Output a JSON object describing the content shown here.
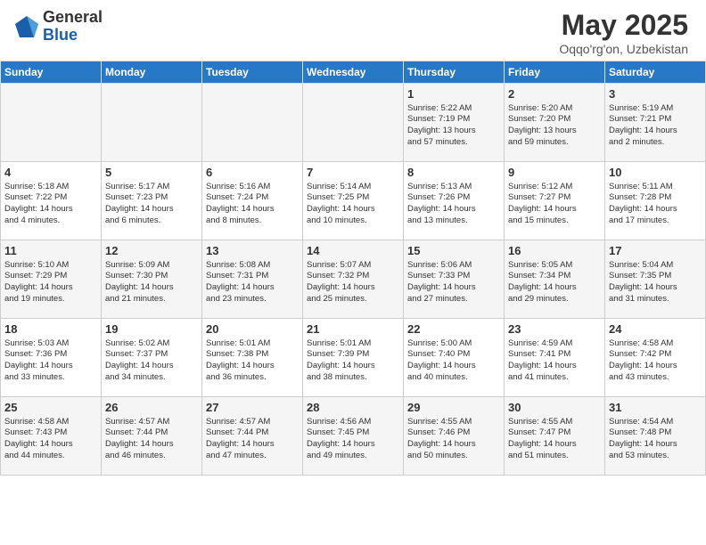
{
  "header": {
    "logo_general": "General",
    "logo_blue": "Blue",
    "month": "May 2025",
    "location": "Oqqo'rg'on, Uzbekistan"
  },
  "days_of_week": [
    "Sunday",
    "Monday",
    "Tuesday",
    "Wednesday",
    "Thursday",
    "Friday",
    "Saturday"
  ],
  "weeks": [
    [
      {
        "day": "",
        "info": ""
      },
      {
        "day": "",
        "info": ""
      },
      {
        "day": "",
        "info": ""
      },
      {
        "day": "",
        "info": ""
      },
      {
        "day": "1",
        "info": "Sunrise: 5:22 AM\nSunset: 7:19 PM\nDaylight: 13 hours\nand 57 minutes."
      },
      {
        "day": "2",
        "info": "Sunrise: 5:20 AM\nSunset: 7:20 PM\nDaylight: 13 hours\nand 59 minutes."
      },
      {
        "day": "3",
        "info": "Sunrise: 5:19 AM\nSunset: 7:21 PM\nDaylight: 14 hours\nand 2 minutes."
      }
    ],
    [
      {
        "day": "4",
        "info": "Sunrise: 5:18 AM\nSunset: 7:22 PM\nDaylight: 14 hours\nand 4 minutes."
      },
      {
        "day": "5",
        "info": "Sunrise: 5:17 AM\nSunset: 7:23 PM\nDaylight: 14 hours\nand 6 minutes."
      },
      {
        "day": "6",
        "info": "Sunrise: 5:16 AM\nSunset: 7:24 PM\nDaylight: 14 hours\nand 8 minutes."
      },
      {
        "day": "7",
        "info": "Sunrise: 5:14 AM\nSunset: 7:25 PM\nDaylight: 14 hours\nand 10 minutes."
      },
      {
        "day": "8",
        "info": "Sunrise: 5:13 AM\nSunset: 7:26 PM\nDaylight: 14 hours\nand 13 minutes."
      },
      {
        "day": "9",
        "info": "Sunrise: 5:12 AM\nSunset: 7:27 PM\nDaylight: 14 hours\nand 15 minutes."
      },
      {
        "day": "10",
        "info": "Sunrise: 5:11 AM\nSunset: 7:28 PM\nDaylight: 14 hours\nand 17 minutes."
      }
    ],
    [
      {
        "day": "11",
        "info": "Sunrise: 5:10 AM\nSunset: 7:29 PM\nDaylight: 14 hours\nand 19 minutes."
      },
      {
        "day": "12",
        "info": "Sunrise: 5:09 AM\nSunset: 7:30 PM\nDaylight: 14 hours\nand 21 minutes."
      },
      {
        "day": "13",
        "info": "Sunrise: 5:08 AM\nSunset: 7:31 PM\nDaylight: 14 hours\nand 23 minutes."
      },
      {
        "day": "14",
        "info": "Sunrise: 5:07 AM\nSunset: 7:32 PM\nDaylight: 14 hours\nand 25 minutes."
      },
      {
        "day": "15",
        "info": "Sunrise: 5:06 AM\nSunset: 7:33 PM\nDaylight: 14 hours\nand 27 minutes."
      },
      {
        "day": "16",
        "info": "Sunrise: 5:05 AM\nSunset: 7:34 PM\nDaylight: 14 hours\nand 29 minutes."
      },
      {
        "day": "17",
        "info": "Sunrise: 5:04 AM\nSunset: 7:35 PM\nDaylight: 14 hours\nand 31 minutes."
      }
    ],
    [
      {
        "day": "18",
        "info": "Sunrise: 5:03 AM\nSunset: 7:36 PM\nDaylight: 14 hours\nand 33 minutes."
      },
      {
        "day": "19",
        "info": "Sunrise: 5:02 AM\nSunset: 7:37 PM\nDaylight: 14 hours\nand 34 minutes."
      },
      {
        "day": "20",
        "info": "Sunrise: 5:01 AM\nSunset: 7:38 PM\nDaylight: 14 hours\nand 36 minutes."
      },
      {
        "day": "21",
        "info": "Sunrise: 5:01 AM\nSunset: 7:39 PM\nDaylight: 14 hours\nand 38 minutes."
      },
      {
        "day": "22",
        "info": "Sunrise: 5:00 AM\nSunset: 7:40 PM\nDaylight: 14 hours\nand 40 minutes."
      },
      {
        "day": "23",
        "info": "Sunrise: 4:59 AM\nSunset: 7:41 PM\nDaylight: 14 hours\nand 41 minutes."
      },
      {
        "day": "24",
        "info": "Sunrise: 4:58 AM\nSunset: 7:42 PM\nDaylight: 14 hours\nand 43 minutes."
      }
    ],
    [
      {
        "day": "25",
        "info": "Sunrise: 4:58 AM\nSunset: 7:43 PM\nDaylight: 14 hours\nand 44 minutes."
      },
      {
        "day": "26",
        "info": "Sunrise: 4:57 AM\nSunset: 7:44 PM\nDaylight: 14 hours\nand 46 minutes."
      },
      {
        "day": "27",
        "info": "Sunrise: 4:57 AM\nSunset: 7:44 PM\nDaylight: 14 hours\nand 47 minutes."
      },
      {
        "day": "28",
        "info": "Sunrise: 4:56 AM\nSunset: 7:45 PM\nDaylight: 14 hours\nand 49 minutes."
      },
      {
        "day": "29",
        "info": "Sunrise: 4:55 AM\nSunset: 7:46 PM\nDaylight: 14 hours\nand 50 minutes."
      },
      {
        "day": "30",
        "info": "Sunrise: 4:55 AM\nSunset: 7:47 PM\nDaylight: 14 hours\nand 51 minutes."
      },
      {
        "day": "31",
        "info": "Sunrise: 4:54 AM\nSunset: 7:48 PM\nDaylight: 14 hours\nand 53 minutes."
      }
    ]
  ]
}
